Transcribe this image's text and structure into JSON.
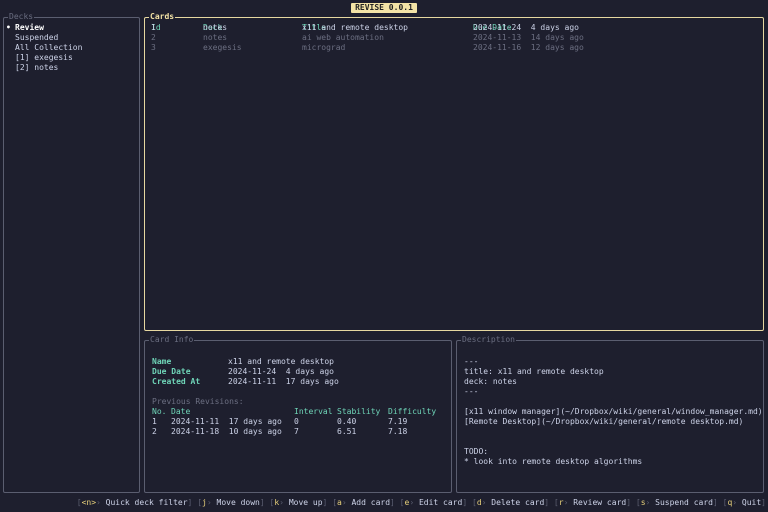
{
  "app_title": "REVISE 0.0.1",
  "decks": {
    "title": "Decks",
    "items": [
      {
        "label": "Review",
        "selected": true
      },
      {
        "label": "Suspended"
      },
      {
        "label": "All Collection"
      },
      {
        "label": "[1] exegesis"
      },
      {
        "label": "[2] notes"
      }
    ],
    "bullet": "•"
  },
  "cards": {
    "title": "Cards",
    "columns": [
      "Id",
      "Deck",
      "Title",
      "Due Date"
    ],
    "rows": [
      {
        "id": "1",
        "deck": "notes",
        "title": "x11 and remote desktop",
        "due": "2024-11-24  4 days ago",
        "selected": true
      },
      {
        "id": "2",
        "deck": "notes",
        "title": "ai web automation",
        "due": "2024-11-13  14 days ago"
      },
      {
        "id": "3",
        "deck": "exegesis",
        "title": "micrograd",
        "due": "2024-11-16  12 days ago"
      }
    ]
  },
  "card_info": {
    "title": "Card Info",
    "fields": [
      {
        "label": "Name",
        "value": "x11 and remote desktop"
      },
      {
        "label": "Due Date",
        "value": "2024-11-24  4 days ago"
      },
      {
        "label": "Created At",
        "value": "2024-11-11  17 days ago"
      }
    ],
    "revisions_label": "Previous Revisions:",
    "rev_columns": [
      "No.",
      "Date",
      "Interval",
      "Stability",
      "Difficulty"
    ],
    "revisions": [
      {
        "no": "1",
        "date": "2024-11-11  17 days ago",
        "interval": "0",
        "stability": "0.40",
        "difficulty": "7.19"
      },
      {
        "no": "2",
        "date": "2024-11-18  10 days ago",
        "interval": "7",
        "stability": "6.51",
        "difficulty": "7.18"
      }
    ]
  },
  "description": {
    "title": "Description",
    "lines": [
      "---",
      "title: x11 and remote desktop",
      "deck: notes",
      "---",
      "",
      "[x11 window manager](~/Dropbox/wiki/general/window_manager.md)",
      "[Remote Desktop](~/Dropbox/wiki/general/remote desktop.md)",
      "",
      "",
      "TODO:",
      "* look into remote desktop algorithms"
    ]
  },
  "footer": [
    {
      "key": "<n>",
      "label": "Quick deck filter"
    },
    {
      "key": "j",
      "label": "Move down"
    },
    {
      "key": "k",
      "label": "Move up"
    },
    {
      "key": "a",
      "label": "Add card"
    },
    {
      "key": "e",
      "label": "Edit card"
    },
    {
      "key": "d",
      "label": "Delete card"
    },
    {
      "key": "r",
      "label": "Review card"
    },
    {
      "key": "s",
      "label": "Suspend card"
    },
    {
      "key": "q",
      "label": "Quit"
    }
  ],
  "colors": {
    "accent": "#f3e3a6",
    "header": "#6fd5b8",
    "dim": "#6c6f82",
    "background": "#1e1f2e"
  }
}
